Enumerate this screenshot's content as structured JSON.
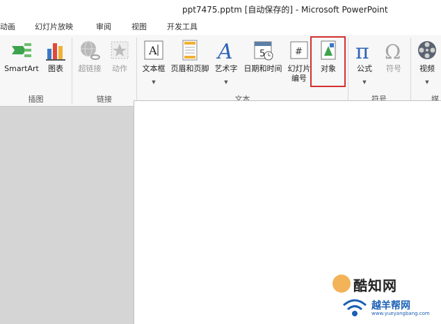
{
  "window": {
    "title": "ppt7475.pptm [自动保存的] - Microsoft PowerPoint"
  },
  "menu": [
    "动画",
    "幻灯片放映",
    "审阅",
    "视图",
    "开发工具"
  ],
  "ribbon": {
    "groups": {
      "illustrations": "插图",
      "links": "链接",
      "text": "文本",
      "symbols": "符号",
      "media": "媒"
    },
    "buttons": {
      "smartart": "SmartArt",
      "chart": "图表",
      "hyperlink": "超链接",
      "action": "动作",
      "textbox": "文本框",
      "header_footer": "页眉和页脚",
      "wordart": "艺术字",
      "datetime": "日期和时间",
      "slide_number_1": "幻灯片",
      "slide_number_2": "编号",
      "object": "对象",
      "equation": "公式",
      "symbol": "符号",
      "video": "视频"
    },
    "highlight_color": "#d32f2f"
  },
  "watermarks": {
    "brand1": "酷知网",
    "brand2": "越羊帮网",
    "brand2_url": "www.yueyangbang.com"
  },
  "colors": {
    "background": "#d5d5d5",
    "ribbon": "#f7f7f7",
    "accent_blue": "#1a5fb4"
  }
}
